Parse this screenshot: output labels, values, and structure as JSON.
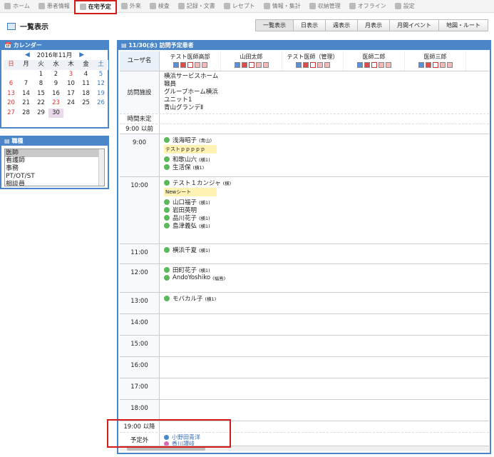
{
  "nav": {
    "items": [
      {
        "label": "ホーム",
        "icon": "home-icon"
      },
      {
        "label": "患者情報",
        "icon": "patient-icon"
      },
      {
        "label": "在宅予定",
        "icon": "gear-icon",
        "active": true
      },
      {
        "label": "外来",
        "icon": "clinic-icon"
      },
      {
        "label": "検査",
        "icon": "test-icon"
      },
      {
        "label": "記録・文書",
        "icon": "document-icon"
      },
      {
        "label": "レセプト",
        "icon": "receipt-icon"
      },
      {
        "label": "情報・集計",
        "icon": "chart-icon"
      },
      {
        "label": "収納管理",
        "icon": "register-icon"
      },
      {
        "label": "オフライン",
        "icon": "offline-icon"
      },
      {
        "label": "設定",
        "icon": "settings-icon"
      }
    ]
  },
  "page": {
    "title": "一覧表示"
  },
  "tabs": [
    "一覧表示",
    "日表示",
    "週表示",
    "月表示",
    "月間イベント",
    "地図・ルート"
  ],
  "calendar": {
    "header": "カレンダー",
    "month": "2016年11月",
    "weekdays": [
      "日",
      "月",
      "火",
      "水",
      "木",
      "金",
      "土"
    ],
    "days": [
      "",
      "",
      "1",
      "2",
      "3",
      "4",
      "5",
      "6",
      "7",
      "8",
      "9",
      "10",
      "11",
      "12",
      "13",
      "14",
      "15",
      "16",
      "17",
      "18",
      "19",
      "20",
      "21",
      "22",
      "23",
      "24",
      "25",
      "26",
      "27",
      "28",
      "29",
      "30",
      "",
      "",
      ""
    ],
    "selected": "30"
  },
  "category": {
    "header": "職種",
    "items": [
      "医師",
      "看護師",
      "事務",
      "PT/OT/ST",
      "相談員"
    ],
    "selected": "医師"
  },
  "schedule": {
    "header": "11/30(水) 訪問予定患者",
    "user_col": "ユーザ名",
    "users": [
      "テスト医師高部",
      "山田太郎",
      "テスト医師（管理）",
      "医師二郎",
      "医師三郎"
    ],
    "facility_label": "訪問施設",
    "facilities": [
      "横浜サービスホーム",
      "職員",
      "グループホーム横浜ユニット1",
      "青山グランデⅡ"
    ],
    "untimed": "時間未定",
    "before9": "9:00 以前",
    "after19": "19:00 以降",
    "unscheduled": "予定外",
    "unscheduled_names": [
      "小野田青洋",
      "香川讃岐"
    ],
    "slots": [
      {
        "time": "9:00",
        "entries": [
          {
            "name": "浅海昭子",
            "tag": "(青山)"
          },
          {
            "note": "テストｐｐｐｐｐ"
          },
          {
            "name": "和歌山六",
            "tag": "(横1)"
          },
          {
            "name": "生活保",
            "tag": "(横1)"
          }
        ]
      },
      {
        "time": "10:00",
        "entries": [
          {
            "name": "テスト１カンジャ",
            "tag": "(横)"
          },
          {
            "note": "Newシート"
          },
          {
            "name": "山口福子",
            "tag": "(横1)"
          },
          {
            "name": "岩田英明",
            "tag": ""
          },
          {
            "name": "品川花子",
            "tag": "(横1)"
          },
          {
            "name": "島津義弘",
            "tag": "(横1)"
          }
        ]
      },
      {
        "time": "11:00",
        "entries": [
          {
            "name": "横浜千夏",
            "tag": "(横1)"
          }
        ]
      },
      {
        "time": "12:00",
        "entries": [
          {
            "name": "田町花子",
            "tag": "(横1)"
          },
          {
            "name": "AndoYoshiko",
            "tag": "(福島)"
          }
        ]
      },
      {
        "time": "13:00",
        "entries": [
          {
            "name": "モバカル子",
            "tag": "(横1)"
          }
        ]
      },
      {
        "time": "14:00",
        "entries": []
      },
      {
        "time": "15:00",
        "entries": []
      },
      {
        "time": "16:00",
        "entries": []
      },
      {
        "time": "17:00",
        "entries": []
      },
      {
        "time": "18:00",
        "entries": []
      }
    ]
  },
  "colors": {
    "accent": "#4a86c8",
    "highlight": "#d21b1b",
    "note": "#fff2b3"
  }
}
